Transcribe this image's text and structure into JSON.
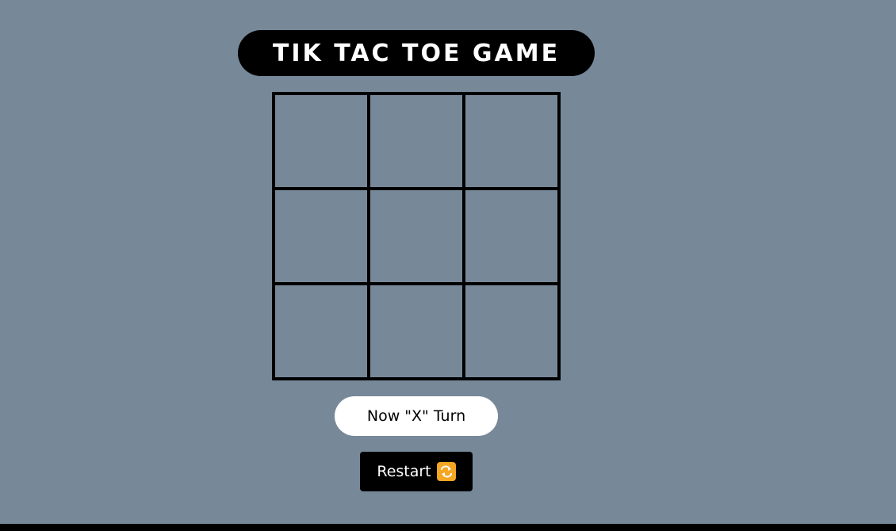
{
  "colors": {
    "background": "#778899",
    "title_bg": "#000000",
    "title_text": "#ffffff",
    "grid_lines": "#000000",
    "status_bg": "#ffffff",
    "status_text": "#000000",
    "restart_bg": "#000000",
    "restart_text": "#ffffff",
    "restart_icon": "#f5a623"
  },
  "header": {
    "title": "TIK TAC TOE GAME"
  },
  "board": {
    "cells": [
      "",
      "",
      "",
      "",
      "",
      "",
      "",
      "",
      ""
    ]
  },
  "status": {
    "message": "Now \"X\" Turn"
  },
  "controls": {
    "restart_label": "Restart",
    "restart_icon": "repeat-icon"
  }
}
